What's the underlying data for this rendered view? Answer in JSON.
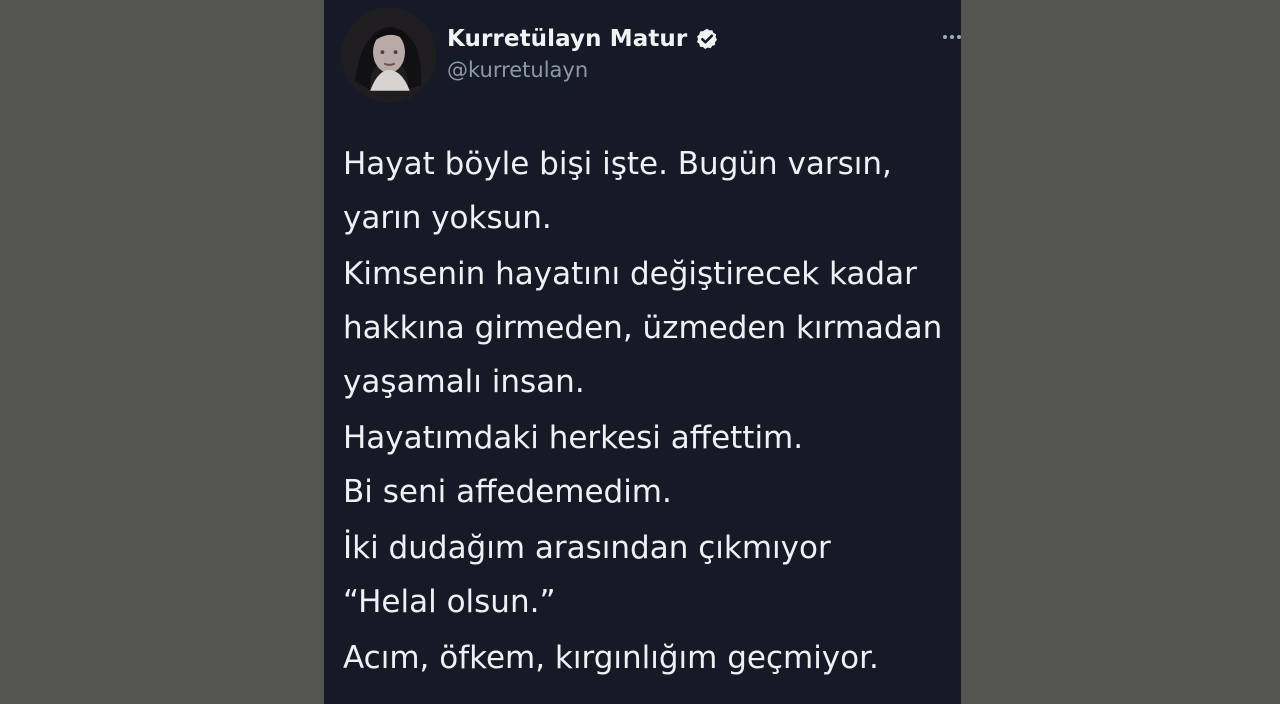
{
  "profile": {
    "display_name": "Kurretülayn Matur",
    "handle": "@kurretulayn",
    "avatar_icon": "avatar-photo-icon",
    "verified_icon": "verified-badge-icon",
    "more_icon": "more-options-icon"
  },
  "tweet": {
    "paragraphs": [
      {
        "lines": [
          "Hayat böyle bişi işte. Bugün varsın,",
          "yarın yoksun."
        ]
      },
      {
        "lines": [
          "Kimsenin hayatını değiştirecek kadar",
          "hakkına girmeden, üzmeden kırmadan",
          "yaşamalı insan."
        ]
      },
      {
        "lines": [
          "Hayatımdaki herkesi affettim.",
          "Bi seni affedemedim."
        ]
      },
      {
        "lines": [
          "İki dudağım arasından çıkmıyor",
          "“Helal olsun.”"
        ]
      },
      {
        "lines": [
          "Acım, öfkem, kırgınlığım geçmiyor."
        ]
      }
    ]
  },
  "colors": {
    "background": "#545450",
    "card": "#151a26",
    "text": "#eef1f4",
    "secondary_text": "#8f99a6",
    "verified": "#f2f2f2"
  }
}
